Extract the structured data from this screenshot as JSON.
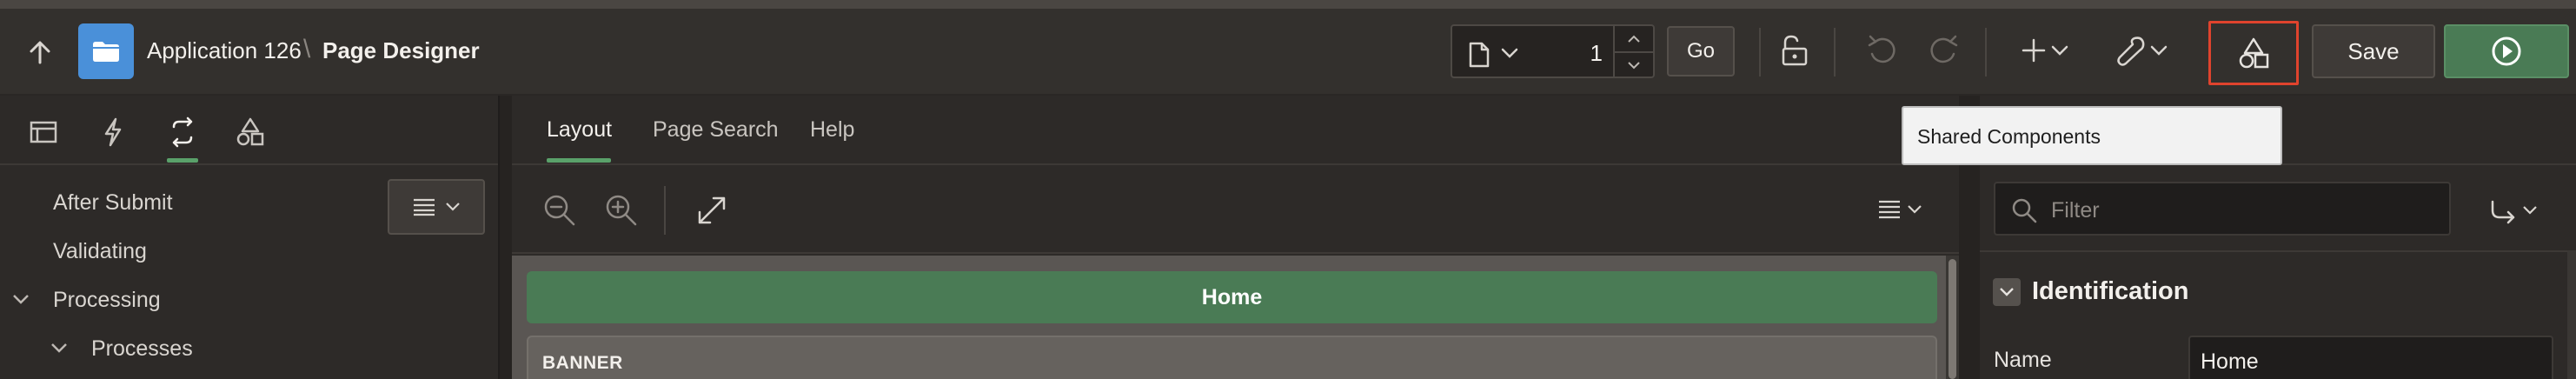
{
  "header": {
    "app_title": "Application 126",
    "separator": "\\",
    "page_title": "Page Designer",
    "page_number": "1",
    "go_label": "Go",
    "save_label": "Save"
  },
  "tooltip": {
    "text": "Shared Components"
  },
  "left_panel": {
    "tree": {
      "after_submit": "After Submit",
      "validating": "Validating",
      "processing": "Processing",
      "processes": "Processes"
    }
  },
  "center_panel": {
    "tabs": [
      "Layout",
      "Page Search",
      "Help"
    ],
    "canvas": {
      "home": "Home",
      "banner": "BANNER"
    }
  },
  "right_panel": {
    "filter_placeholder": "Filter",
    "section_title": "Identification",
    "name_label": "Name",
    "name_value": "Home"
  },
  "colors": {
    "accent_green": "#4a7b55",
    "highlight_red": "#e0432d",
    "app_icon_blue": "#4a90d9"
  },
  "icons": {
    "header": [
      "up-arrow-icon",
      "folder-icon",
      "page-icon",
      "lock-icon",
      "undo-icon",
      "redo-icon",
      "plus-icon",
      "wrench-icon",
      "shapes-icon",
      "play-icon"
    ],
    "left_tabs": [
      "rendering-icon",
      "dynamic-actions-icon",
      "processing-icon",
      "shared-components-icon"
    ]
  }
}
